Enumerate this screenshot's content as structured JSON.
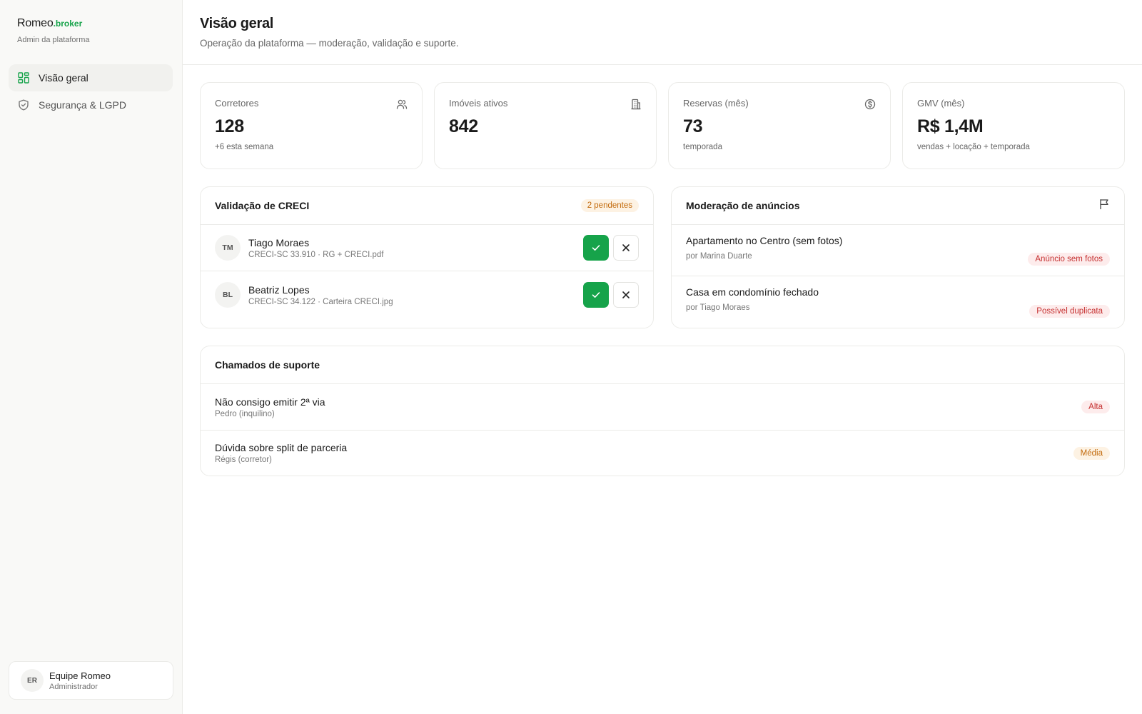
{
  "brand": {
    "name": "Romeo",
    "suffix": ".broker",
    "subtitle": "Admin da plataforma",
    "accent": "#16a34a"
  },
  "nav": [
    {
      "label": "Visão geral",
      "icon": "dashboard-grid-icon",
      "active": true
    },
    {
      "label": "Segurança & LGPD",
      "icon": "shield-check-icon",
      "active": false
    }
  ],
  "user": {
    "initials": "ER",
    "name": "Equipe Romeo",
    "role": "Administrador"
  },
  "header": {
    "title": "Visão geral",
    "subtitle": "Operação da plataforma — moderação, validação e suporte."
  },
  "stats": [
    {
      "label": "Corretores",
      "value": "128",
      "note": "+6 esta semana",
      "icon": "users-icon"
    },
    {
      "label": "Imóveis ativos",
      "value": "842",
      "note": "",
      "icon": "building-icon"
    },
    {
      "label": "Reservas (mês)",
      "value": "73",
      "note": "temporada",
      "icon": "dollar-circle-icon"
    },
    {
      "label": "GMV (mês)",
      "value": "R$ 1,4M",
      "note": "vendas + locação + temporada",
      "icon": ""
    }
  ],
  "creci": {
    "title": "Validação de CRECI",
    "badge": "2 pendentes",
    "items": [
      {
        "initials": "TM",
        "name": "Tiago Moraes",
        "doc": "CRECI-SC 33.910 · RG + CRECI.pdf"
      },
      {
        "initials": "BL",
        "name": "Beatriz Lopes",
        "doc": "CRECI-SC 34.122 · Carteira CRECI.jpg"
      }
    ]
  },
  "moderation": {
    "title": "Moderação de anúncios",
    "icon": "flag-icon",
    "items": [
      {
        "title": "Apartamento no Centro (sem fotos)",
        "by": "por Marina Duarte",
        "flag": "Anúncio sem fotos"
      },
      {
        "title": "Casa em condomínio fechado",
        "by": "por Tiago Moraes",
        "flag": "Possível duplicata"
      }
    ]
  },
  "support": {
    "title": "Chamados de suporte",
    "items": [
      {
        "title": "Não consigo emitir 2ª via",
        "who": "Pedro (inquilino)",
        "priority": "Alta"
      },
      {
        "title": "Dúvida sobre split de parceria",
        "who": "Régis (corretor)",
        "priority": "Média"
      }
    ]
  }
}
